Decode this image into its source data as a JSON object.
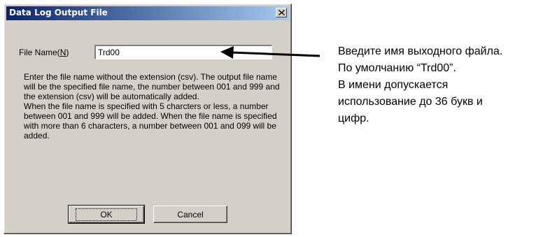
{
  "dialog": {
    "title": "Data Log Output File",
    "field_label_prefix": "File Name(",
    "field_label_key": "N",
    "field_label_suffix": ")",
    "file_name_value": "Trd00",
    "description": [
      "Enter the file name without the extension (csv). The output file name will be the specified file name, the number between 001 and 999  and the extension (csv) will be automatically added.",
      "When the file name is specified with 5 charcters or less, a number between 001 and 999 will be added. When the file name is specified with more than 6 characters, a number between 001 and 099 will be added."
    ],
    "ok_label": "OK",
    "cancel_label": "Cancel"
  },
  "annotation": {
    "lines": [
      "Введите имя выходного файла.",
      "По умолчанию “Trd00”.",
      "В имени допускается",
      "использование до 36 букв и",
      "цифр."
    ]
  }
}
